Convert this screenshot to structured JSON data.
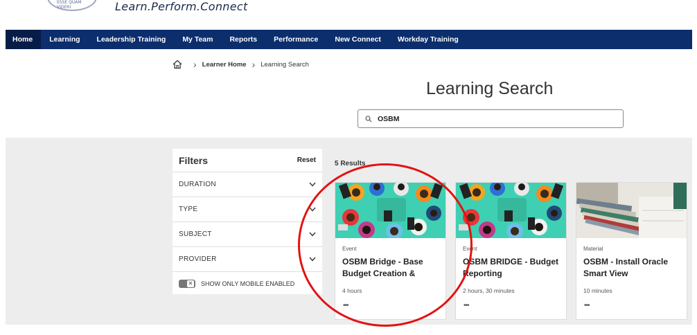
{
  "header": {
    "logo_text": "ESSE QUAM VIDERI",
    "tagline": "Learn.Perform.Connect"
  },
  "nav": {
    "items": [
      {
        "label": "Home"
      },
      {
        "label": "Learning"
      },
      {
        "label": "Leadership Training"
      },
      {
        "label": "My Team"
      },
      {
        "label": "Reports"
      },
      {
        "label": "Performance"
      },
      {
        "label": "New Connect"
      },
      {
        "label": "Workday Training"
      }
    ],
    "active": "Home",
    "bg_color": "#0c2e6d"
  },
  "breadcrumb": {
    "home_icon": "home-icon",
    "items": [
      "Learner Home",
      "Learning Search"
    ]
  },
  "page_title": "Learning Search",
  "search": {
    "value": "OSBM",
    "icon": "search-icon"
  },
  "filters": {
    "title": "Filters",
    "reset_label": "Reset",
    "groups": [
      "DURATION",
      "TYPE",
      "SUBJECT",
      "PROVIDER"
    ],
    "mobile_toggle_label": "SHOW ONLY MOBILE ENABLED"
  },
  "results": {
    "count_label": "5 Results",
    "cards": [
      {
        "type": "Event",
        "title": "OSBM Bridge - Base Budget Creation &",
        "duration": "4 hours",
        "more": "•••",
        "image": "team-meeting-photo"
      },
      {
        "type": "Event",
        "title": "OSBM BRIDGE - Budget Reporting",
        "duration": "2 hours, 30 minutes",
        "more": "•••",
        "image": "team-meeting-photo"
      },
      {
        "type": "Material",
        "title": "OSBM - Install Oracle Smart View",
        "duration": "10 minutes",
        "more": "•••",
        "image": "books-photo"
      }
    ]
  },
  "annotation_color": "#e31212"
}
